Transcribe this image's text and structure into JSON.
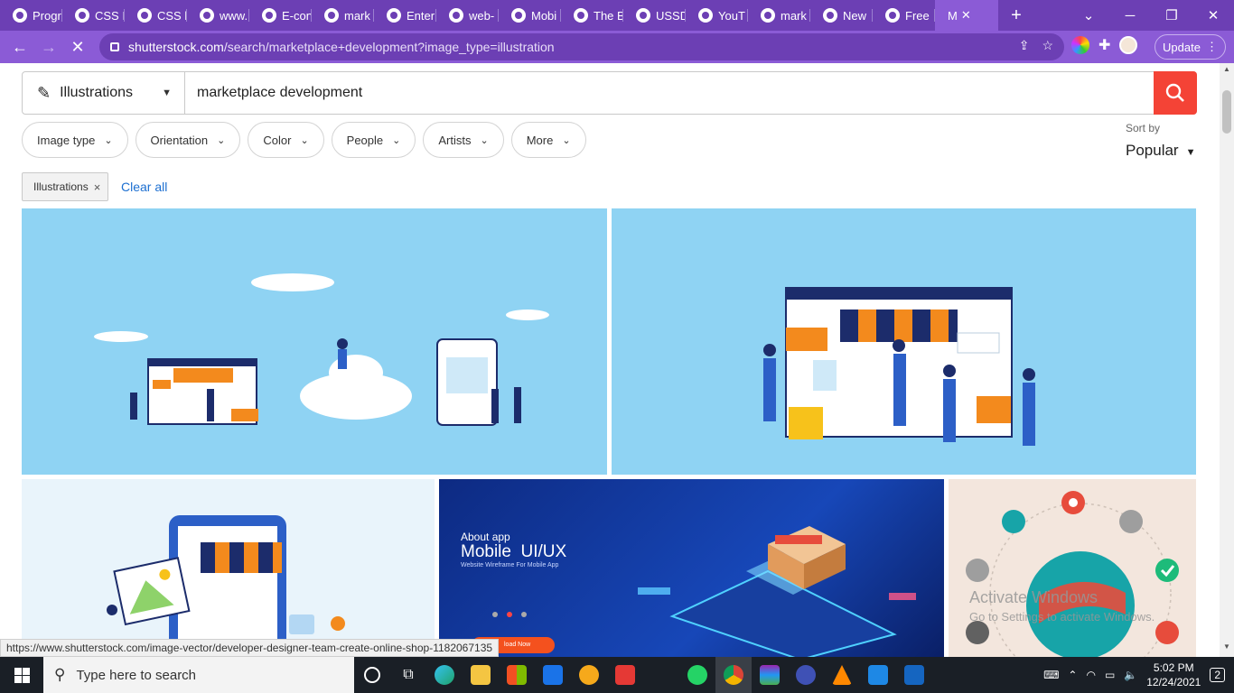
{
  "tabs": [
    {
      "label": "Progr"
    },
    {
      "label": "CSS I"
    },
    {
      "label": "CSS b"
    },
    {
      "label": "www."
    },
    {
      "label": "E-con"
    },
    {
      "label": "mark"
    },
    {
      "label": "Enter"
    },
    {
      "label": "web-"
    },
    {
      "label": "Mobi"
    },
    {
      "label": "The B"
    },
    {
      "label": "USSD"
    },
    {
      "label": "YouT"
    },
    {
      "label": "mark"
    },
    {
      "label": "New"
    },
    {
      "label": "Free"
    }
  ],
  "active_tab": {
    "label": "M"
  },
  "address": {
    "domain": "shutterstock.com",
    "path": "/search/marketplace+development?image_type=illustration"
  },
  "update_label": "Update",
  "search": {
    "type_label": "Illustrations",
    "query": "marketplace development"
  },
  "filters": [
    {
      "label": "Image type"
    },
    {
      "label": "Orientation"
    },
    {
      "label": "Color"
    },
    {
      "label": "People"
    },
    {
      "label": "Artists"
    },
    {
      "label": "More"
    }
  ],
  "sort": {
    "label": "Sort by",
    "value": "Popular"
  },
  "active_filter_chip": "Illustrations",
  "clear_all": "Clear all",
  "results": {
    "mobile_card": {
      "eyebrow": "About app",
      "title": "Mobile  UI/UX",
      "subtitle": "Website Wireframe For Mobile App",
      "button": "load Now"
    }
  },
  "status_url": "https://www.shutterstock.com/image-vector/developer-designer-team-create-online-shop-1182067135",
  "watermark": {
    "line1": "Activate Windows",
    "line2": "Go to Settings to activate Windows."
  },
  "taskbar": {
    "search_placeholder": "Type here to search",
    "time": "5:02 PM",
    "date": "12/24/2021",
    "notifications": "2"
  },
  "colors": {
    "chrome_dark": "#6c3fb4",
    "chrome_light": "#8b5bd6",
    "accent_red": "#f44336",
    "link_blue": "#1c6fd1",
    "sky": "#8fd3f3"
  }
}
